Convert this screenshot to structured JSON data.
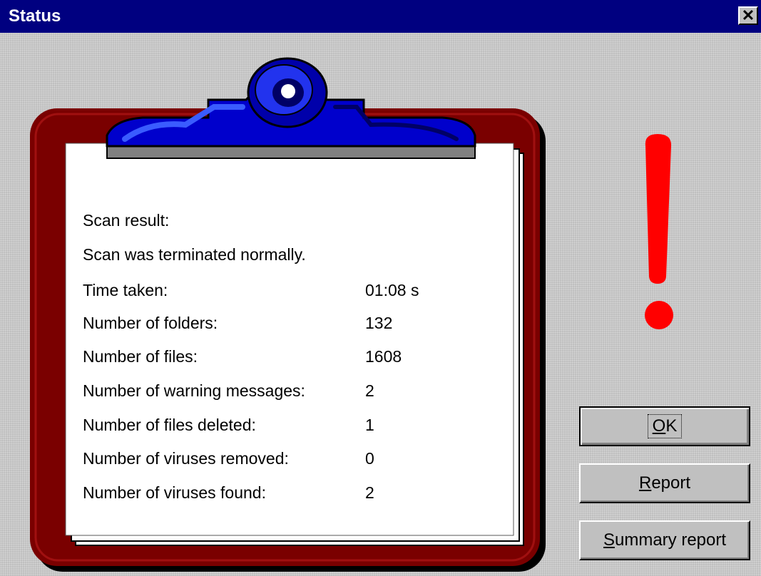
{
  "window": {
    "title": "Status",
    "close_glyph": "✕"
  },
  "scan": {
    "heading": "Scan result:",
    "message": "Scan was terminated normally.",
    "rows": [
      {
        "label": "Time taken:",
        "value": "01:08 s"
      },
      {
        "label": "Number of folders:",
        "value": "132"
      },
      {
        "label": "Number of files:",
        "value": "1608"
      },
      {
        "label": "Number of warning messages:",
        "value": "2"
      },
      {
        "label": "Number of files deleted:",
        "value": "1"
      },
      {
        "label": "Number of viruses removed:",
        "value": "0"
      },
      {
        "label": "Number of viruses found:",
        "value": "2"
      }
    ]
  },
  "buttons": {
    "ok": {
      "accel": "O",
      "rest": "K"
    },
    "report": {
      "accel": "R",
      "rest": "eport"
    },
    "summary": {
      "accel": "S",
      "rest": "ummary report"
    }
  },
  "icons": {
    "clipboard": "clipboard-icon",
    "alert": "exclamation-icon"
  },
  "colors": {
    "titlebar": "#000080",
    "clipboard_frame": "#7a0000",
    "clip_blue": "#0000cc",
    "exclamation": "#ff0000"
  }
}
